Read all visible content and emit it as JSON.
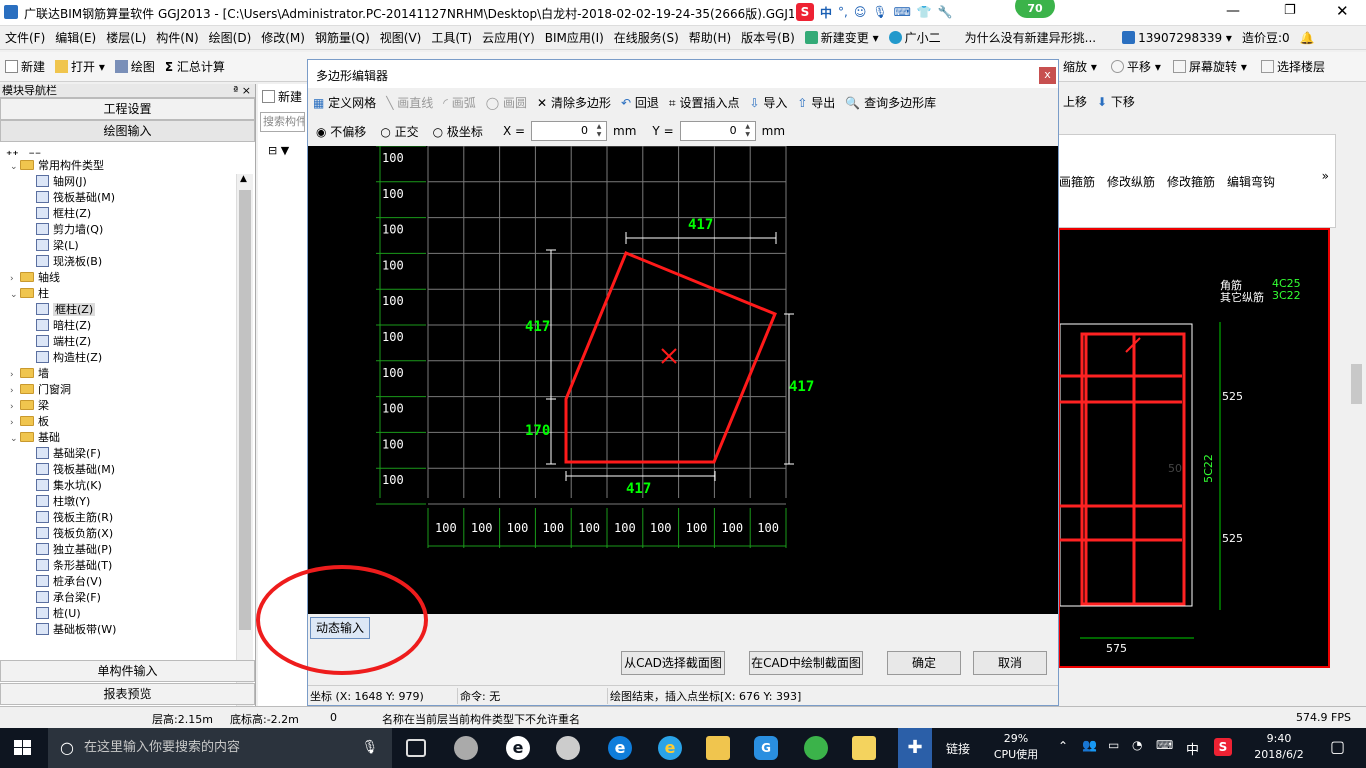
{
  "window": {
    "title": "广联达BIM钢筋算量软件 GGJ2013 - [C:\\Users\\Administrator.PC-20141127NRHM\\Desktop\\白龙村-2018-02-02-19-24-35(2666版).GGJ12]"
  },
  "tray_top": {
    "ime_label": "中",
    "badge": "70"
  },
  "menu": [
    "文件(F)",
    "编辑(E)",
    "楼层(L)",
    "构件(N)",
    "绘图(D)",
    "修改(M)",
    "钢筋量(Q)",
    "视图(V)",
    "工具(T)",
    "云应用(Y)",
    "BIM应用(I)",
    "在线服务(S)",
    "帮助(H)",
    "版本号(B)",
    "新建变更",
    "广小二"
  ],
  "menu_right": {
    "ad_text": "为什么没有新建异形挑...",
    "phone": "13907298339",
    "coins": "造价豆:0"
  },
  "toolbar": {
    "new": "新建",
    "open": "打开",
    "draw": "绘图",
    "sum": "汇总计算",
    "zoom": "缩放",
    "pan": "平移",
    "rotate": "屏幕旋转",
    "select_floor": "选择楼层",
    "move_up": "上移",
    "move_down": "下移"
  },
  "leftpanel": {
    "header": "模块导航栏",
    "pin": "ª ×",
    "btn_project": "工程设置",
    "btn_draw": "绘图输入",
    "btn_single": "单构件输入",
    "btn_report": "报表预览",
    "tree": [
      {
        "label": "常用构件类型",
        "level": 0,
        "type": "folder",
        "expanded": true
      },
      {
        "label": "轴网(J)",
        "level": 1,
        "type": "leaf"
      },
      {
        "label": "筏板基础(M)",
        "level": 1,
        "type": "leaf"
      },
      {
        "label": "框柱(Z)",
        "level": 1,
        "type": "leaf"
      },
      {
        "label": "剪力墙(Q)",
        "level": 1,
        "type": "leaf"
      },
      {
        "label": "梁(L)",
        "level": 1,
        "type": "leaf"
      },
      {
        "label": "现浇板(B)",
        "level": 1,
        "type": "leaf"
      },
      {
        "label": "轴线",
        "level": 0,
        "type": "folder",
        "expanded": false
      },
      {
        "label": "柱",
        "level": 0,
        "type": "folder",
        "expanded": true
      },
      {
        "label": "框柱(Z)",
        "level": 1,
        "type": "leaf",
        "selected": true
      },
      {
        "label": "暗柱(Z)",
        "level": 1,
        "type": "leaf"
      },
      {
        "label": "端柱(Z)",
        "level": 1,
        "type": "leaf"
      },
      {
        "label": "构造柱(Z)",
        "level": 1,
        "type": "leaf"
      },
      {
        "label": "墙",
        "level": 0,
        "type": "folder",
        "expanded": false
      },
      {
        "label": "门窗洞",
        "level": 0,
        "type": "folder",
        "expanded": false
      },
      {
        "label": "梁",
        "level": 0,
        "type": "folder",
        "expanded": false
      },
      {
        "label": "板",
        "level": 0,
        "type": "folder",
        "expanded": false
      },
      {
        "label": "基础",
        "level": 0,
        "type": "folder",
        "expanded": true
      },
      {
        "label": "基础梁(F)",
        "level": 1,
        "type": "leaf"
      },
      {
        "label": "筏板基础(M)",
        "level": 1,
        "type": "leaf"
      },
      {
        "label": "集水坑(K)",
        "level": 1,
        "type": "leaf"
      },
      {
        "label": "柱墩(Y)",
        "level": 1,
        "type": "leaf"
      },
      {
        "label": "筏板主筋(R)",
        "level": 1,
        "type": "leaf"
      },
      {
        "label": "筏板负筋(X)",
        "level": 1,
        "type": "leaf"
      },
      {
        "label": "独立基础(P)",
        "level": 1,
        "type": "leaf"
      },
      {
        "label": "条形基础(T)",
        "level": 1,
        "type": "leaf"
      },
      {
        "label": "桩承台(V)",
        "level": 1,
        "type": "leaf"
      },
      {
        "label": "承台梁(F)",
        "level": 1,
        "type": "leaf"
      },
      {
        "label": "桩(U)",
        "level": 1,
        "type": "leaf"
      },
      {
        "label": "基础板带(W)",
        "level": 1,
        "type": "leaf"
      }
    ]
  },
  "midpanel": {
    "new": "新建",
    "search_placeholder": "搜索构件"
  },
  "rightpanel": {
    "tools": [
      "画箍筋",
      "修改纵筋",
      "修改箍筋",
      "编辑弯钩"
    ],
    "corner_label": "角筋",
    "corner_value": "4C25",
    "other_label": "其它纵筋",
    "other_value": "3C22",
    "dim_a": "525",
    "dim_b": "525",
    "dim_c": "575",
    "dim_side": "5C22",
    "dim_mid": "50"
  },
  "dialog": {
    "title": "多边形编辑器",
    "close": "x",
    "tb1": {
      "grid": "定义网格",
      "line": "画直线",
      "arc": "画弧",
      "circle": "画圆",
      "clear": "清除多边形",
      "undo": "回退",
      "insert": "设置插入点",
      "import": "导入",
      "export": "导出",
      "query": "查询多边形库"
    },
    "tb2": {
      "opt1": "不偏移",
      "opt2": "正交",
      "opt3": "极坐标",
      "x_label": "X =",
      "x_val": "0",
      "y_label": "Y =",
      "y_val": "0",
      "unit": "mm"
    },
    "dyn_input": "动态输入",
    "btn_cad_select": "从CAD选择截面图",
    "btn_cad_draw": "在CAD中绘制截面图",
    "btn_ok": "确定",
    "btn_cancel": "取消",
    "status_coord": "坐标 (X: 1648 Y: 979)",
    "status_cmd": "命令: 无",
    "status_msg": "绘图结束，插入点坐标[X: 676 Y: 393]"
  },
  "canvas": {
    "grid_x_labels": [
      "100",
      "100",
      "100",
      "100",
      "100",
      "100",
      "100",
      "100",
      "100",
      "100"
    ],
    "grid_y_labels": [
      "100",
      "100",
      "100",
      "100",
      "100",
      "100",
      "100",
      "100",
      "100",
      "100"
    ],
    "dims": {
      "top": "417",
      "left": "417",
      "right": "417",
      "bottom": "417",
      "left_small": "170"
    }
  },
  "appstatus": {
    "floor_height": "层高:2.15m",
    "bottom_height": "底标高:-2.2m",
    "zero": "0",
    "message": "名称在当前层当前构件类型下不允许重名",
    "fps": "574.9 FPS"
  },
  "taskbar": {
    "search": "在这里输入你要搜索的内容",
    "link": "链接",
    "cpu_pct": "29%",
    "cpu_label": "CPU使用",
    "ime": "中",
    "time": "9:40",
    "date": "2018/6/2"
  },
  "colors": {
    "accent": "#0078d7",
    "grid": "#7a7a7a",
    "polygon": "#ff1a1a",
    "dim": "#00ff00"
  }
}
